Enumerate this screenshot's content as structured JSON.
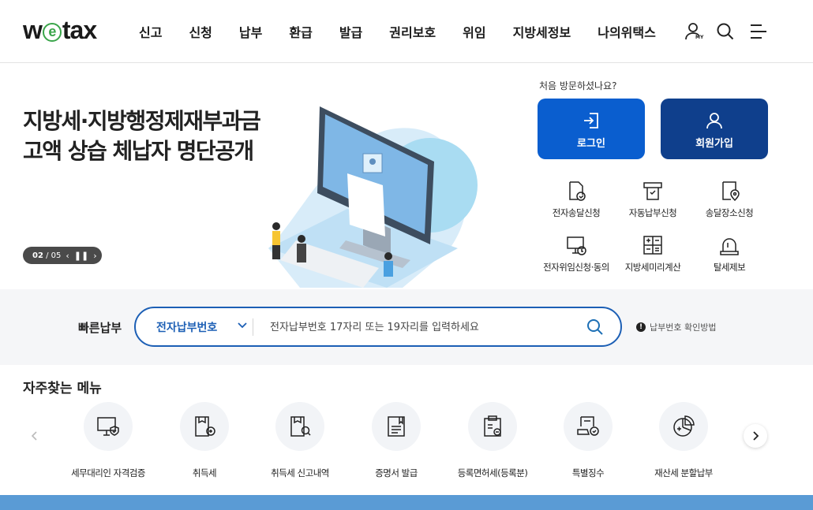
{
  "header": {
    "logo_text": "wetax",
    "nav": [
      "신고",
      "신청",
      "납부",
      "환급",
      "발급",
      "권리보호",
      "위임",
      "지방세정보",
      "나의위택스"
    ],
    "icons": [
      "my-user-icon",
      "search-icon",
      "menu-icon"
    ],
    "my_badge": "MY"
  },
  "banner": {
    "title_line1": "지방세·지방행정제재부과금",
    "title_line2": "고액 상습 체납자 명단공개",
    "page_current": "02",
    "page_total": "/ 05"
  },
  "login": {
    "visit_text": "처음 방문하셨나요?",
    "login_label": "로그인",
    "signup_label": "회원가입",
    "colors": {
      "login": "#0a5ecf",
      "signup": "#0f3f8c"
    }
  },
  "quick_services": [
    {
      "label": "전자송달신청",
      "icon": "doc-check-icon"
    },
    {
      "label": "자동납부신청",
      "icon": "auto-pay-icon"
    },
    {
      "label": "송달장소신청",
      "icon": "doc-location-icon"
    },
    {
      "label": "전자위임신청·동의",
      "icon": "monitor-delegate-icon"
    },
    {
      "label": "지방세미리계산",
      "icon": "calculator-icon"
    },
    {
      "label": "탈세제보",
      "icon": "siren-icon"
    }
  ],
  "quick_pay": {
    "label": "빠른납부",
    "select_value": "전자납부번호",
    "placeholder": "전자납부번호 17자리 또는 19자리를 입력하세요",
    "help": "납부번호 확인방법"
  },
  "frequent": {
    "title": "자주찾는 메뉴",
    "items": [
      {
        "label": "세무대리인 자격검증",
        "icon": "monitor-shield-icon"
      },
      {
        "label": "취득세",
        "icon": "acquisition-tax-icon"
      },
      {
        "label": "취득세 신고내역",
        "icon": "acquisition-history-icon"
      },
      {
        "label": "증명서 발급",
        "icon": "certificate-icon"
      },
      {
        "label": "등록면허세(등록분)",
        "icon": "clipboard-tax-icon"
      },
      {
        "label": "특별징수",
        "icon": "special-collection-icon"
      },
      {
        "label": "재산세 분할납부",
        "icon": "pie-split-icon"
      }
    ]
  }
}
